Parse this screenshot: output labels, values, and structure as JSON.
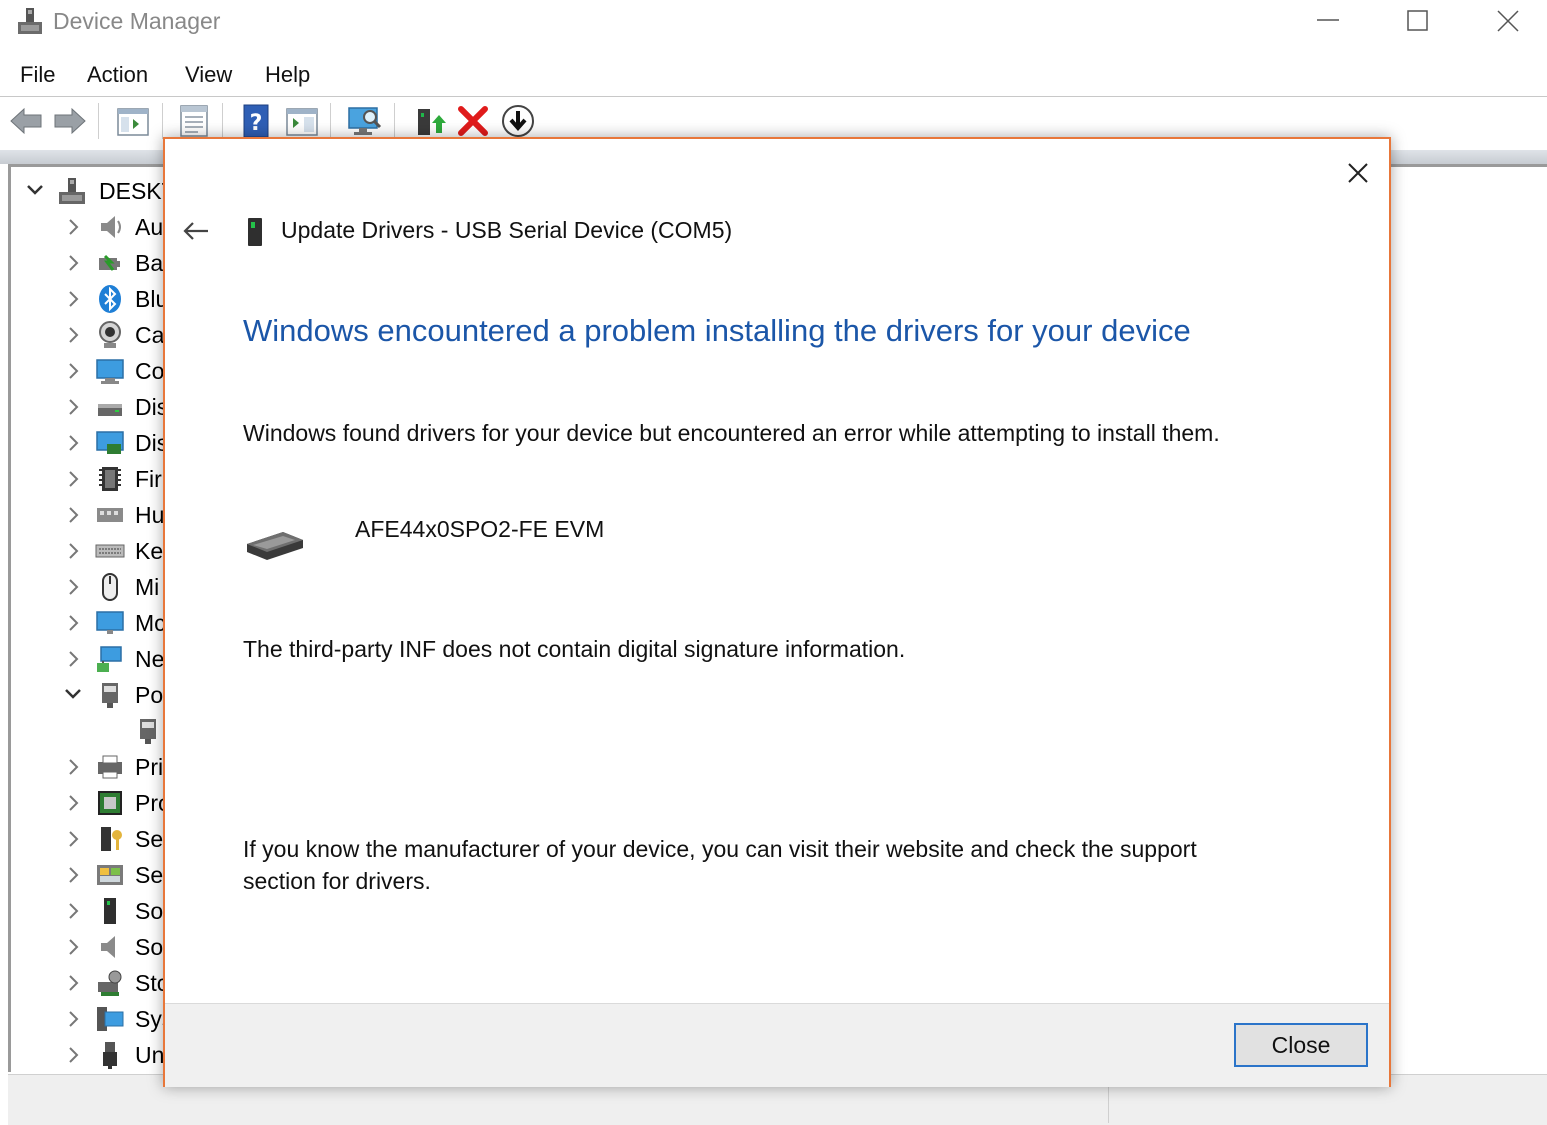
{
  "window": {
    "title": "Device Manager"
  },
  "menu": [
    "File",
    "Action",
    "View",
    "Help"
  ],
  "tree": {
    "root_label": "DESKT",
    "items": [
      {
        "label": "Au",
        "icon": "speaker-icon"
      },
      {
        "label": "Ba",
        "icon": "battery-icon"
      },
      {
        "label": "Blu",
        "icon": "bluetooth-icon"
      },
      {
        "label": "Ca",
        "icon": "camera-icon"
      },
      {
        "label": "Co",
        "icon": "computer-icon"
      },
      {
        "label": "Dis",
        "icon": "disk-drive-icon"
      },
      {
        "label": "Dis",
        "icon": "display-adapter-icon"
      },
      {
        "label": "Fir",
        "icon": "firmware-icon"
      },
      {
        "label": "Hu",
        "icon": "human-interface-icon"
      },
      {
        "label": "Ke",
        "icon": "keyboard-icon"
      },
      {
        "label": "Mi",
        "icon": "mouse-icon"
      },
      {
        "label": "Mc",
        "icon": "monitor-icon"
      },
      {
        "label": "Ne",
        "icon": "network-icon"
      },
      {
        "label": "Po",
        "icon": "port-icon"
      },
      {
        "label": "",
        "icon": "port-child-icon"
      },
      {
        "label": "Pri",
        "icon": "printer-icon"
      },
      {
        "label": "Pro",
        "icon": "processor-icon"
      },
      {
        "label": "Sec",
        "icon": "security-device-icon"
      },
      {
        "label": "Ser",
        "icon": "sensor-icon"
      },
      {
        "label": "So",
        "icon": "software-device-icon"
      },
      {
        "label": "So",
        "icon": "sound-icon"
      },
      {
        "label": "Stc",
        "icon": "storage-controller-icon"
      },
      {
        "label": "Sys",
        "icon": "system-device-icon"
      },
      {
        "label": "Un",
        "icon": "usb-icon"
      }
    ]
  },
  "dialog": {
    "title": "Update Drivers - USB Serial Device (COM5)",
    "heading": "Windows encountered a problem installing the drivers for your device",
    "paragraph_1": "Windows found drivers for your device but encountered an error while attempting to install them.",
    "device_name": "AFE44x0SPO2-FE EVM",
    "paragraph_2": "The third-party INF does not contain digital signature information.",
    "paragraph_3": "If you know the manufacturer of your device, you can visit their website and check the support section for drivers.",
    "close_label": "Close"
  },
  "colors": {
    "accent_border": "#e8773a",
    "heading_blue": "#1b56a8",
    "button_focus": "#2b74c9"
  }
}
